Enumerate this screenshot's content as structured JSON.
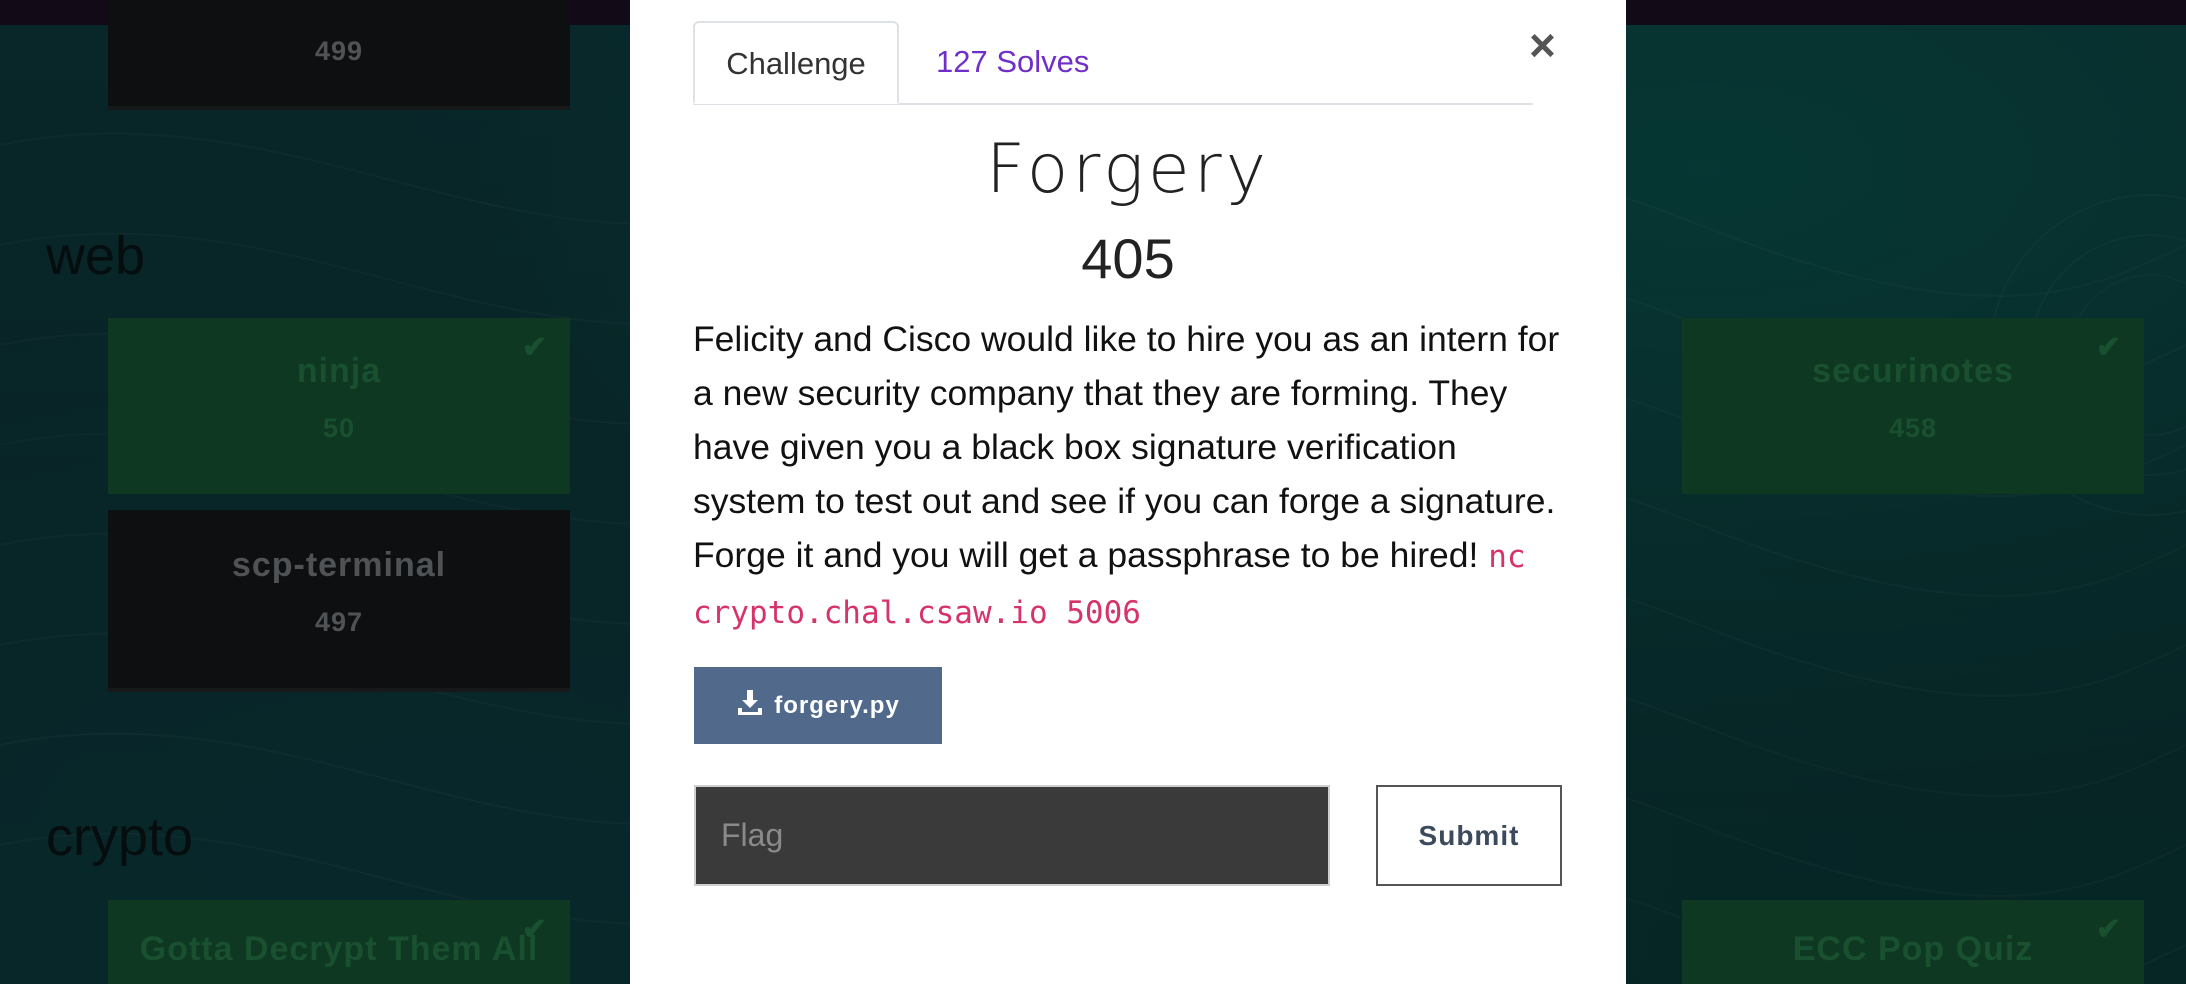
{
  "background": {
    "top_card": {
      "points": "499"
    },
    "categories": [
      {
        "title": "web"
      },
      {
        "title": "crypto"
      }
    ],
    "cards": {
      "ninja": {
        "name": "ninja",
        "points": "50"
      },
      "scp_terminal": {
        "name": "scp-terminal",
        "points": "497"
      },
      "securinotes": {
        "name": "securinotes",
        "points": "458"
      },
      "gotta_decrypt": {
        "name": "Gotta Decrypt Them All"
      },
      "ecc_pop_quiz": {
        "name": "ECC Pop Quiz"
      }
    },
    "check_glyph": "✔"
  },
  "modal": {
    "tabs": {
      "challenge": "Challenge",
      "solves": "127 Solves"
    },
    "close": "×",
    "name": "Forgery",
    "value": "405",
    "description": "Felicity and Cisco would like to hire you as an intern for a new security company that they are forming. They have given you a black box signature verification system to test out and see if you can forge a signature. Forge it and you will get a passphrase to be hired! ",
    "command": "nc crypto.chal.csaw.io 5006",
    "file": {
      "label": "forgery.py",
      "icon": "download-icon"
    },
    "flag": {
      "placeholder": "Flag",
      "value": ""
    },
    "submit": "Submit"
  },
  "colors": {
    "solved_card": "#1c6b41",
    "unsolved_card": "#1b1e22",
    "solves_link": "#6f2fc8",
    "file_button": "#51698a",
    "code_text": "#d6336c"
  }
}
